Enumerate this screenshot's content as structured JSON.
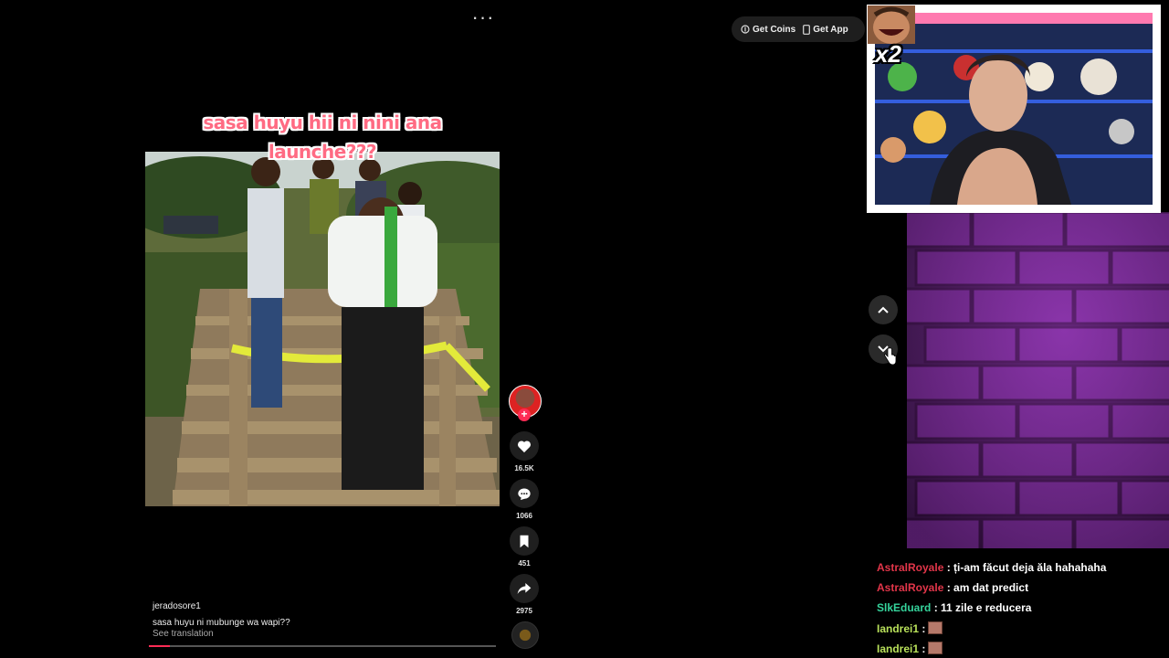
{
  "video_caption_overlay": "sasa huyu hii ni nini ana launche???",
  "post": {
    "author": "jeradosore1",
    "description": "sasa huyu ni mubunge wa wapi??",
    "see_translation": "See translation",
    "progress": 0.06
  },
  "actions": {
    "likes": "16.5K",
    "comments": "1066",
    "saves": "451",
    "shares": "2975"
  },
  "top_bar": {
    "get_coins": "Get Coins",
    "get_app": "Get App"
  },
  "stream": {
    "emote_multiplier": "x2"
  },
  "chat": [
    {
      "user": "AstralRoyale",
      "user_color": "#e2364a",
      "message": ": ți-am făcut deja ăla hahahaha",
      "emote": false
    },
    {
      "user": "AstralRoyale",
      "user_color": "#e2364a",
      "message": ": am dat predict",
      "emote": false
    },
    {
      "user": "SlkEduard",
      "user_color": "#35d39b",
      "message": ": 11 zile e reducera",
      "emote": false
    },
    {
      "user": "Iandrei1",
      "user_color": "#b8e05a",
      "message": ":",
      "emote": true
    },
    {
      "user": "Iandrei1",
      "user_color": "#b8e05a",
      "message": ":",
      "emote": true
    }
  ],
  "colors": {
    "accent": "#fe2c55",
    "background": "#000000",
    "wall_purple": "#7a2a9a"
  }
}
